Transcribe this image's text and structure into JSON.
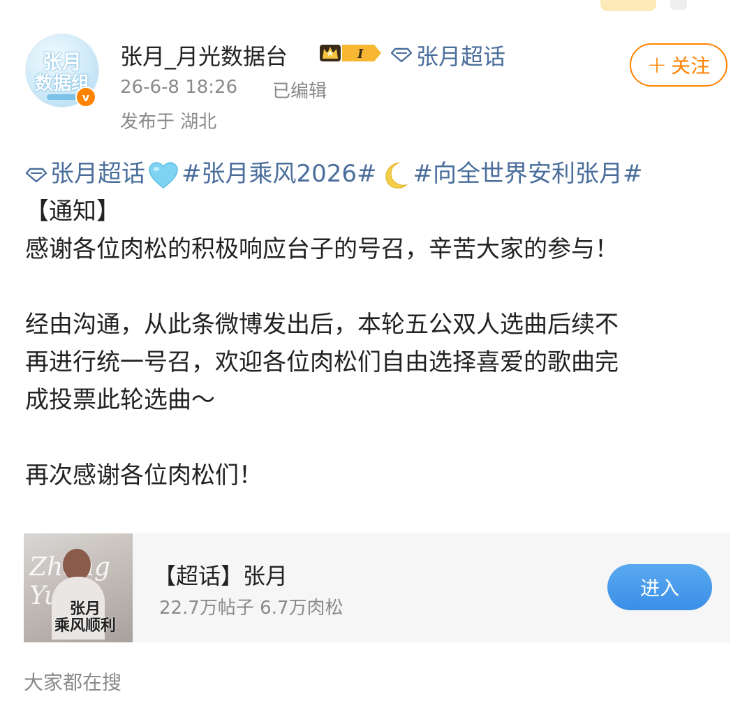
{
  "header": {
    "username": "张月_月光数据台",
    "level_badge": "I",
    "chaohua_link": "张月超话",
    "timestamp": "26-6-8 18:26",
    "edited": "已编辑",
    "location": "发布于 湖北",
    "follow_label": "关注",
    "avatar_text_1": "张月",
    "avatar_text_2": "数据组"
  },
  "post": {
    "tag_chaohua": "张月超话",
    "tag_1": "#张月乘风2026#",
    "tag_2": "#向全世界安利张月#",
    "notice": "【通知】",
    "line_1": "感谢各位肉松的积极响应台子的号召，辛苦大家的参与！",
    "line_2": "经由沟通，从此条微博发出后，本轮五公双人选曲后续不",
    "line_3": "再进行统一号召，欢迎各位肉松们自由选择喜爱的歌曲完",
    "line_4": "成投票此轮选曲～",
    "line_5": "再次感谢各位肉松们！"
  },
  "card": {
    "title": "【超话】张月",
    "stats": "22.7万帖子 6.7万肉松",
    "enter_label": "进入",
    "thumb_script": "Zhang Yue",
    "thumb_cn": "张月\n乘风顺利"
  },
  "footer": {
    "search_hint": "大家都在搜"
  },
  "colors": {
    "link": "#4a6e9c",
    "follow": "#ff8200",
    "enter": "#3a8ee6"
  }
}
